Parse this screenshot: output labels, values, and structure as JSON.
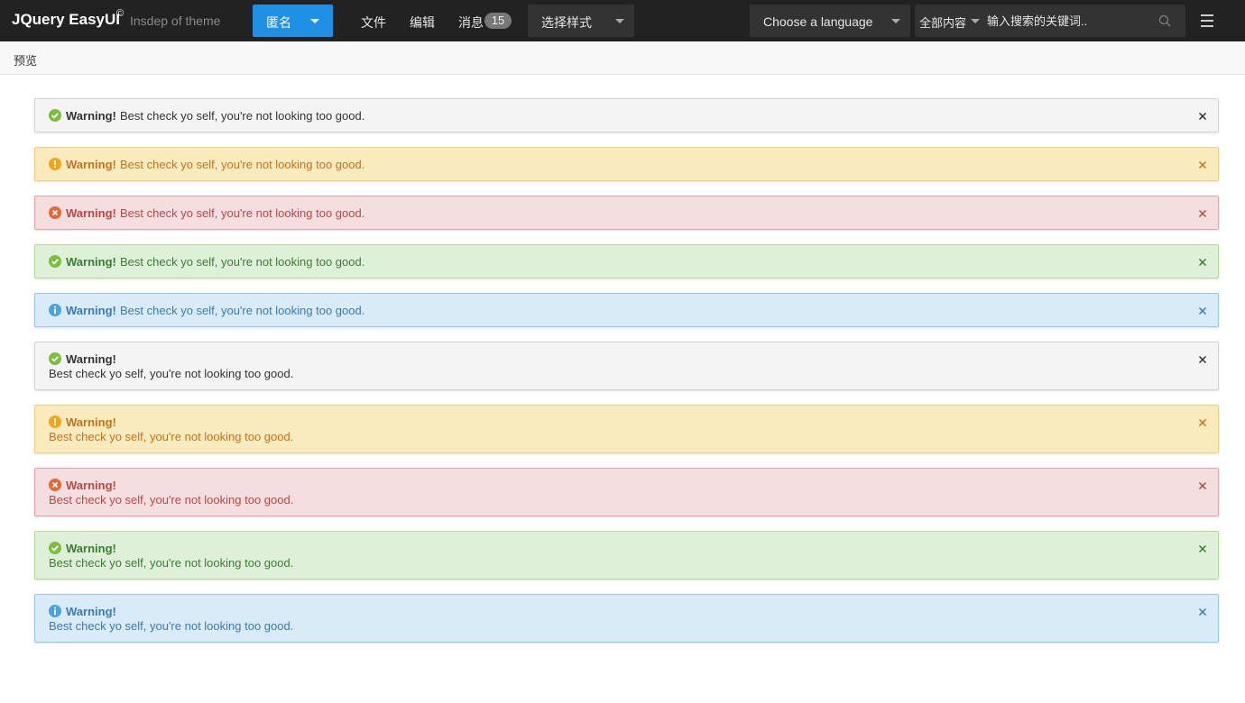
{
  "header": {
    "brand": "JQuery EasyUI",
    "brand_mark": "©",
    "brand_subtitle": "Insdep of theme",
    "user_button": "匿名",
    "nav": [
      "文件",
      "编辑",
      "消息"
    ],
    "messages_badge": "15",
    "style_select": "选择样式",
    "language_select": "Choose a language",
    "search_scope": "全部内容",
    "search_placeholder": "输入搜索的关键词.."
  },
  "breadcrumb": "预览",
  "alerts": [
    {
      "variant": "default",
      "icon": "check-circle-icon",
      "title": "Warning!",
      "message": "Best check yo self, you're not looking too good."
    },
    {
      "variant": "warning",
      "icon": "exclamation-circle-icon",
      "title": "Warning!",
      "message": "Best check yo self, you're not looking too good."
    },
    {
      "variant": "danger",
      "icon": "times-circle-icon",
      "title": "Warning!",
      "message": "Best check yo self, you're not looking too good."
    },
    {
      "variant": "success",
      "icon": "check-circle-icon",
      "title": "Warning!",
      "message": "Best check yo self, you're not looking too good."
    },
    {
      "variant": "info",
      "icon": "info-circle-icon",
      "title": "Warning!",
      "message": "Best check yo self, you're not looking too good."
    },
    {
      "variant": "default",
      "icon": "check-circle-icon",
      "title": "Warning!",
      "message": "Best check yo self, you're not looking too good."
    },
    {
      "variant": "warning",
      "icon": "exclamation-circle-icon",
      "title": "Warning!",
      "message": "Best check yo self, you're not looking too good."
    },
    {
      "variant": "danger",
      "icon": "times-circle-icon",
      "title": "Warning!",
      "message": "Best check yo self, you're not looking too good."
    },
    {
      "variant": "success",
      "icon": "check-circle-icon",
      "title": "Warning!",
      "message": "Best check yo self, you're not looking too good."
    },
    {
      "variant": "info",
      "icon": "info-circle-icon",
      "title": "Warning!",
      "message": "Best check yo self, you're not looking too good."
    }
  ],
  "colors": {
    "topbar": "#222222",
    "primary_button": "#1e90e6",
    "icon_check": "#7cbf3e",
    "icon_warning": "#f2a51a",
    "icon_danger": "#e8682f",
    "icon_info": "#4aa3df"
  }
}
